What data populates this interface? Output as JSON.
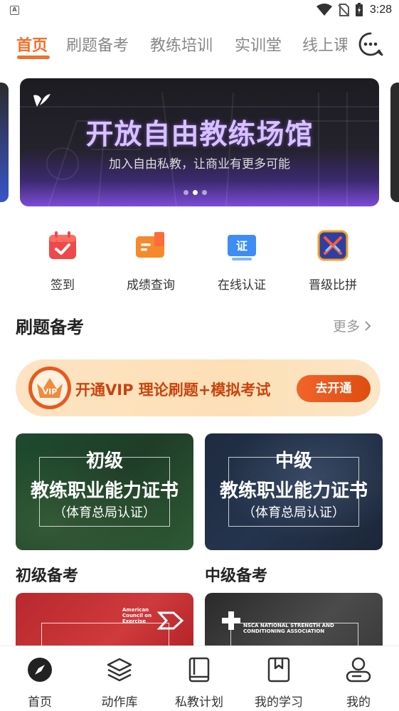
{
  "status_bar": {
    "time": "3:28",
    "app_icon_letter": "A",
    "icons": [
      "wifi-icon",
      "no-sim-icon",
      "battery-charging-icon"
    ]
  },
  "top_tabs": [
    {
      "label": "首页",
      "active": true
    },
    {
      "label": "刷题备考",
      "active": false
    },
    {
      "label": "教练培训",
      "active": false
    },
    {
      "label": "实训堂",
      "active": false
    },
    {
      "label": "线上课",
      "active": false
    }
  ],
  "message_icon": "chat-bubble-icon",
  "banner": {
    "title": "开放自由教练场馆",
    "subtitle": "加入自由私教，让商业有更多可能",
    "page_count": 3,
    "current_page": 2
  },
  "quick_actions": [
    {
      "label": "签到",
      "icon": "calendar-check-icon",
      "color": "#f0484a"
    },
    {
      "label": "成绩查询",
      "icon": "score-card-icon",
      "color": "#f58a2c"
    },
    {
      "label": "在线认证",
      "icon": "certificate-icon",
      "color": "#3d8df5",
      "icon_text": "证"
    },
    {
      "label": "晋级比拼",
      "icon": "battle-icon",
      "color": "#2f3fa0"
    }
  ],
  "section": {
    "title": "刷题备考",
    "more": "更多"
  },
  "vip": {
    "badge_text": "VIP",
    "text": "开通VIP 理论刷题+模拟考试",
    "button": "去开通"
  },
  "cert_cards": [
    {
      "level": "初级",
      "name": "教练职业能力证书",
      "note": "（体育总局认证）"
    },
    {
      "level": "中级",
      "name": "教练职业能力证书",
      "note": "（体育总局认证）"
    }
  ],
  "sub_sections": [
    {
      "title": "初级备考",
      "org": "American Council on Exercise"
    },
    {
      "title": "中级备考",
      "org": "NSCA NATIONAL STRENGTH AND CONDITIONING ASSOCIATION"
    }
  ],
  "bottom_nav": [
    {
      "label": "首页",
      "icon": "compass-icon",
      "active": true
    },
    {
      "label": "动作库",
      "icon": "layers-icon",
      "active": false
    },
    {
      "label": "私教计划",
      "icon": "book-icon",
      "active": false
    },
    {
      "label": "我的学习",
      "icon": "bookmark-icon",
      "active": false
    },
    {
      "label": "我的",
      "icon": "user-icon",
      "active": false
    }
  ],
  "colors": {
    "accent": "#f3702a",
    "vip_text": "#c7440e",
    "vip_button": "#e5561b"
  }
}
